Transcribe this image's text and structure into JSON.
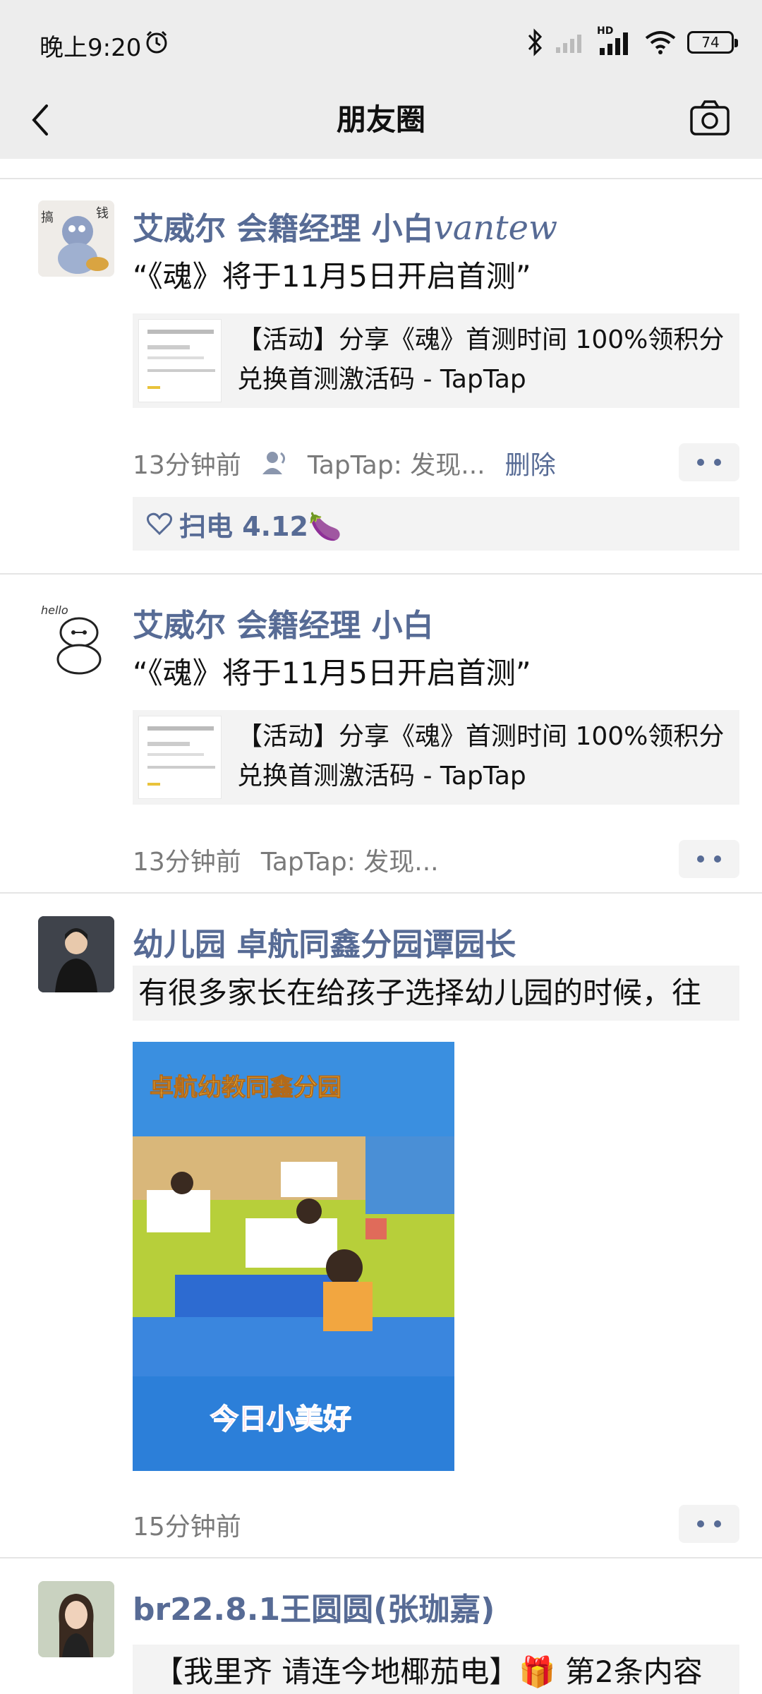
{
  "status_bar": {
    "time": "晚上9:20",
    "battery": "74",
    "network": "HD"
  },
  "nav": {
    "title": "朋友圈"
  },
  "posts": [
    {
      "name": "艾威尔 会籍经理 小白",
      "name_signature": "vantew",
      "text": "“《魂》将于11月5日开启首测”",
      "link_title": "【活动】分享《魂》首测时间 100%领积分兑换首测激活码 - TapTap",
      "time": "13分钟前",
      "source": "TapTap: 发现...",
      "delete": "删除",
      "likes": "扫电 4.12🍆"
    },
    {
      "name": "艾威尔 会籍经理 小白",
      "text": "“《魂》将于11月5日开启首测”",
      "link_title": "【活动】分享《魂》首测时间 100%领积分兑换首测激活码 - TapTap",
      "time": "13分钟前",
      "source": "TapTap: 发现..."
    },
    {
      "name": "幼儿园 卓航同鑫分园谭园长",
      "text": "有很多家长在给孩子选择幼儿园的时候，往",
      "photo_title": "卓航幼教同鑫分园",
      "photo_caption": "今日小美好",
      "time": "15分钟前"
    },
    {
      "name": "br22.8.1王圆圆(张珈嘉)",
      "text": "【我里齐 请连今地椰茄电】🎁 第2条内容"
    }
  ],
  "avatar_texts": {
    "post2": "hello"
  },
  "colors": {
    "link_blue": "#576b95",
    "topbar_bg": "#ededed",
    "card_bg": "#f3f3f3"
  }
}
